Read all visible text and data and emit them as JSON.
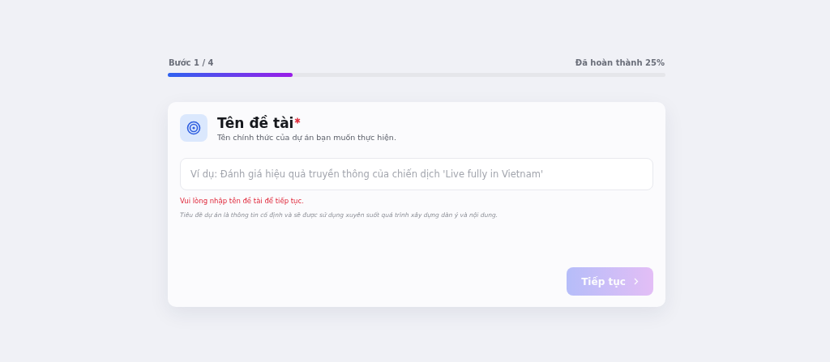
{
  "progress": {
    "step_label": "Bước 1 / 4",
    "completion_label": "Đã hoàn thành 25%",
    "level": 0.25
  },
  "card": {
    "title": "Tên đề tài",
    "required": true,
    "subtitle": "Tên chính thức của dự án bạn muốn thực hiện.",
    "input": {
      "placeholder": "Ví dụ: Đánh giá hiệu quả truyền thông của chiến dịch 'Live fully in Vietnam'"
    },
    "error": "Vui lòng nhập tên đề tài để tiếp tục.",
    "hint": "Tiêu đề dự án là thông tin cố định và sẽ được sử dụng xuyên suốt quá trình xây dựng dàn ý và nội dung.",
    "continue_button": {
      "label": "Tiếp tục",
      "disabled": true
    }
  }
}
